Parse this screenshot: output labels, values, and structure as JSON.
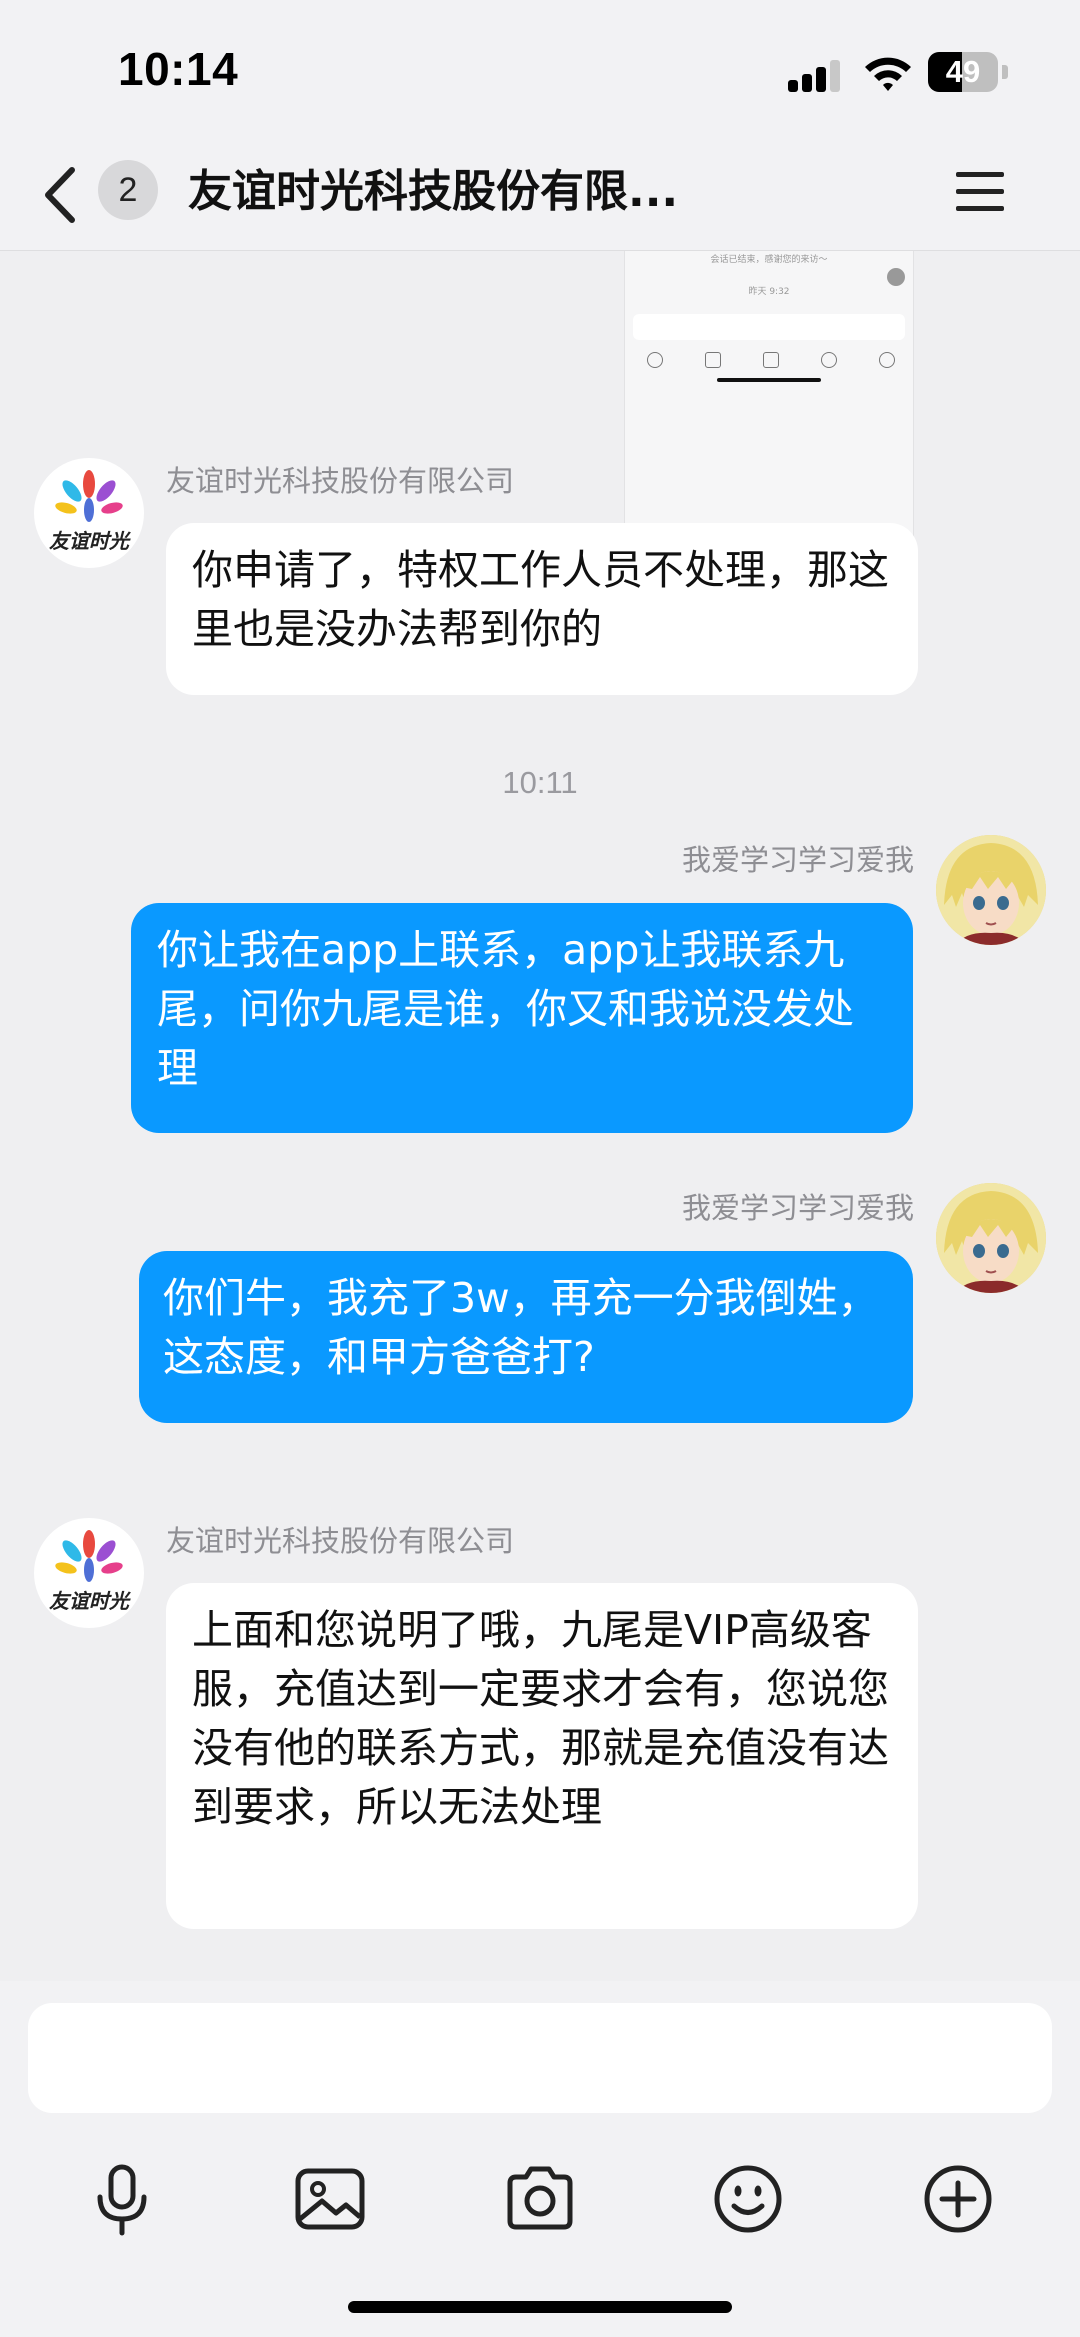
{
  "status_bar": {
    "time": "10:14",
    "battery_percent": 49,
    "battery_label": "49",
    "signal_icon": "cellular-signal-icon",
    "wifi_icon": "wifi-icon"
  },
  "nav": {
    "back_icon": "chevron-left-icon",
    "unread_count": "2",
    "title": "友谊时光科技股份有限...",
    "menu_icon": "hamburger-menu-icon"
  },
  "preview_image": {
    "line1": "会话已结束，感谢您的来访～",
    "line2": "昨天 9:32"
  },
  "messages": [
    {
      "direction": "incoming",
      "sender": "友谊时光科技股份有限公司",
      "avatar": "company-logo-avatar",
      "avatar_text": "友谊时光",
      "text": "你申请了，特权工作人员不处理，那这里也是没办法帮到你的"
    },
    {
      "direction": "outgoing",
      "sender": "我爱学习学习爱我",
      "avatar": "anime-user-avatar",
      "text": "你让我在app上联系，app让我联系九尾，问你九尾是谁，你又和我说没发处理"
    },
    {
      "direction": "outgoing",
      "sender": "我爱学习学习爱我",
      "avatar": "anime-user-avatar",
      "text": "你们牛，我充了3w，再充一分我倒姓，这态度，和甲方爸爸打?"
    },
    {
      "direction": "incoming",
      "sender": "友谊时光科技股份有限公司",
      "avatar": "company-logo-avatar",
      "avatar_text": "友谊时光",
      "text": "上面和您说明了哦，九尾是VIP高级客服，充值达到一定要求才会有，您说您没有他的联系方式，那就是充值没有达到要求，所以无法处理"
    }
  ],
  "time_separator": "10:11",
  "input": {
    "value": "",
    "placeholder": ""
  },
  "toolbar": {
    "icons": [
      "microphone-icon",
      "image-icon",
      "camera-icon",
      "emoji-icon",
      "plus-icon"
    ]
  },
  "colors": {
    "outgoing_bubble": "#0a99ff",
    "incoming_bubble": "#ffffff",
    "background": "#efeff1"
  }
}
